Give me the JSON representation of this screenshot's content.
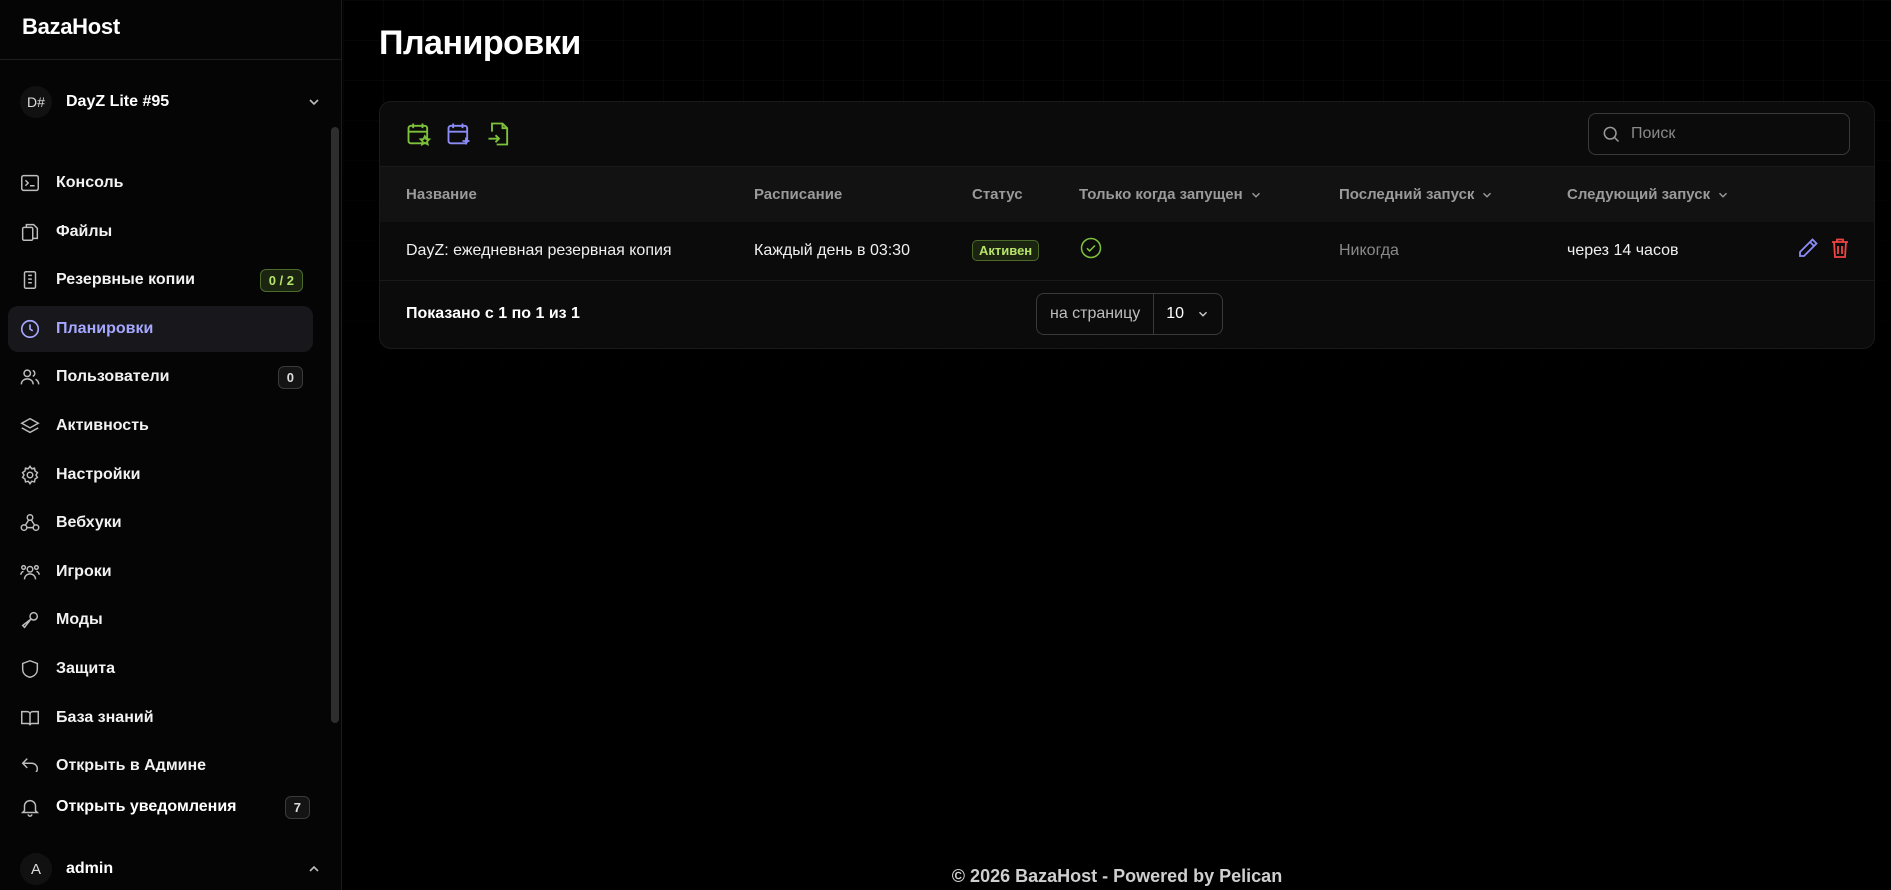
{
  "brand": "BazaHost",
  "server": {
    "avatar": "D#",
    "name": "DayZ Lite #95"
  },
  "nav": [
    {
      "label": "Консоль",
      "icon": "terminal-icon"
    },
    {
      "label": "Файлы",
      "icon": "files-icon"
    },
    {
      "label": "Резервные копии",
      "icon": "database-icon",
      "badge": "0 / 2"
    },
    {
      "label": "Планировки",
      "icon": "clock-icon",
      "active": true
    },
    {
      "label": "Пользователи",
      "icon": "users-icon",
      "badge": "0"
    },
    {
      "label": "Активность",
      "icon": "layers-icon"
    },
    {
      "label": "Настройки",
      "icon": "gear-icon"
    },
    {
      "label": "Вебхуки",
      "icon": "webhook-icon"
    },
    {
      "label": "Игроки",
      "icon": "players-icon"
    },
    {
      "label": "Моды",
      "icon": "wrench-icon"
    },
    {
      "label": "Защита",
      "icon": "shield-icon"
    },
    {
      "label": "База знаний",
      "icon": "book-icon"
    },
    {
      "label": "Открыть в Админе",
      "icon": "arrow-back-icon"
    }
  ],
  "notifications": {
    "label": "Открыть уведомления",
    "count": "7"
  },
  "user": {
    "avatar": "A",
    "name": "admin"
  },
  "page": {
    "title": "Планировки"
  },
  "search": {
    "placeholder": "Поиск"
  },
  "table": {
    "headers": {
      "name": "Название",
      "schedule": "Расписание",
      "status": "Статус",
      "only_running": "Только когда запущен",
      "last_run": "Последний запуск",
      "next_run": "Следующий запуск"
    },
    "rows": [
      {
        "name": "DayZ: ежедневная резервная копия",
        "schedule": "Каждый день в 03:30",
        "status": "Активен",
        "last_run": "Никогда",
        "next_run": "через 14 часов"
      }
    ],
    "shown_text": "Показано с 1 по 1 из 1",
    "per_page_label": "на страницу",
    "per_page_value": "10"
  },
  "footer": "© 2026 BazaHost - Powered by Pelican",
  "colors": {
    "accent": "#a6a8ff",
    "green": "#7ec23c",
    "danger": "#ef4444",
    "purple": "#8b8cf8"
  }
}
